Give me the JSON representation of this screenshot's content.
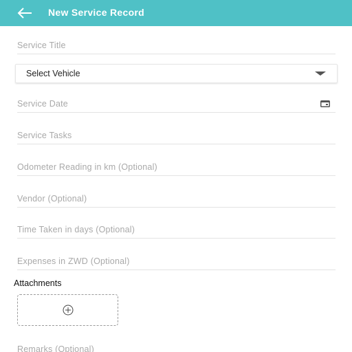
{
  "appbar": {
    "title": "New Service Record",
    "color": "#4fc1c6"
  },
  "fields": {
    "service_title": "Service Title",
    "vehicle_select": "Select Vehicle",
    "service_date": "Service Date",
    "service_tasks": "Service Tasks",
    "odometer": "Odometer Reading in km (Optional)",
    "vendor": "Vendor (Optional)",
    "time_taken": "Time Taken in days (Optional)",
    "expenses": "Expenses in ZWD (Optional)",
    "remarks": "Remarks (Optional)"
  },
  "attachments": {
    "label": "Attachments"
  },
  "icons": {
    "back": "arrow-left-icon",
    "calendar": "calendar-icon",
    "dropdown": "dropdown-caret-icon",
    "add": "add-circle-icon"
  }
}
